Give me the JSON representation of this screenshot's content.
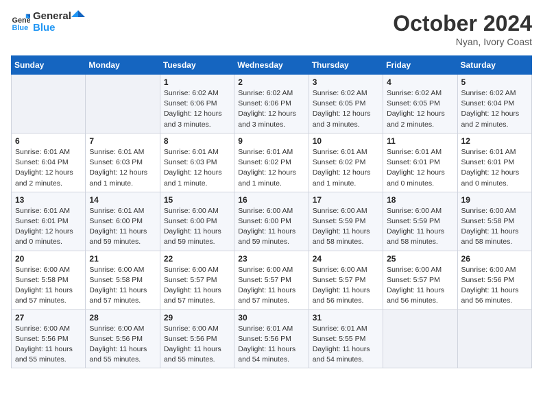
{
  "header": {
    "logo_line1": "General",
    "logo_line2": "Blue",
    "main_title": "October 2024",
    "subtitle": "Nyan, Ivory Coast"
  },
  "weekdays": [
    "Sunday",
    "Monday",
    "Tuesday",
    "Wednesday",
    "Thursday",
    "Friday",
    "Saturday"
  ],
  "weeks": [
    [
      {
        "day": "",
        "info": ""
      },
      {
        "day": "",
        "info": ""
      },
      {
        "day": "1",
        "info": "Sunrise: 6:02 AM\nSunset: 6:06 PM\nDaylight: 12 hours and 3 minutes."
      },
      {
        "day": "2",
        "info": "Sunrise: 6:02 AM\nSunset: 6:06 PM\nDaylight: 12 hours and 3 minutes."
      },
      {
        "day": "3",
        "info": "Sunrise: 6:02 AM\nSunset: 6:05 PM\nDaylight: 12 hours and 3 minutes."
      },
      {
        "day": "4",
        "info": "Sunrise: 6:02 AM\nSunset: 6:05 PM\nDaylight: 12 hours and 2 minutes."
      },
      {
        "day": "5",
        "info": "Sunrise: 6:02 AM\nSunset: 6:04 PM\nDaylight: 12 hours and 2 minutes."
      }
    ],
    [
      {
        "day": "6",
        "info": "Sunrise: 6:01 AM\nSunset: 6:04 PM\nDaylight: 12 hours and 2 minutes."
      },
      {
        "day": "7",
        "info": "Sunrise: 6:01 AM\nSunset: 6:03 PM\nDaylight: 12 hours and 1 minute."
      },
      {
        "day": "8",
        "info": "Sunrise: 6:01 AM\nSunset: 6:03 PM\nDaylight: 12 hours and 1 minute."
      },
      {
        "day": "9",
        "info": "Sunrise: 6:01 AM\nSunset: 6:02 PM\nDaylight: 12 hours and 1 minute."
      },
      {
        "day": "10",
        "info": "Sunrise: 6:01 AM\nSunset: 6:02 PM\nDaylight: 12 hours and 1 minute."
      },
      {
        "day": "11",
        "info": "Sunrise: 6:01 AM\nSunset: 6:01 PM\nDaylight: 12 hours and 0 minutes."
      },
      {
        "day": "12",
        "info": "Sunrise: 6:01 AM\nSunset: 6:01 PM\nDaylight: 12 hours and 0 minutes."
      }
    ],
    [
      {
        "day": "13",
        "info": "Sunrise: 6:01 AM\nSunset: 6:01 PM\nDaylight: 12 hours and 0 minutes."
      },
      {
        "day": "14",
        "info": "Sunrise: 6:01 AM\nSunset: 6:00 PM\nDaylight: 11 hours and 59 minutes."
      },
      {
        "day": "15",
        "info": "Sunrise: 6:00 AM\nSunset: 6:00 PM\nDaylight: 11 hours and 59 minutes."
      },
      {
        "day": "16",
        "info": "Sunrise: 6:00 AM\nSunset: 6:00 PM\nDaylight: 11 hours and 59 minutes."
      },
      {
        "day": "17",
        "info": "Sunrise: 6:00 AM\nSunset: 5:59 PM\nDaylight: 11 hours and 58 minutes."
      },
      {
        "day": "18",
        "info": "Sunrise: 6:00 AM\nSunset: 5:59 PM\nDaylight: 11 hours and 58 minutes."
      },
      {
        "day": "19",
        "info": "Sunrise: 6:00 AM\nSunset: 5:58 PM\nDaylight: 11 hours and 58 minutes."
      }
    ],
    [
      {
        "day": "20",
        "info": "Sunrise: 6:00 AM\nSunset: 5:58 PM\nDaylight: 11 hours and 57 minutes."
      },
      {
        "day": "21",
        "info": "Sunrise: 6:00 AM\nSunset: 5:58 PM\nDaylight: 11 hours and 57 minutes."
      },
      {
        "day": "22",
        "info": "Sunrise: 6:00 AM\nSunset: 5:57 PM\nDaylight: 11 hours and 57 minutes."
      },
      {
        "day": "23",
        "info": "Sunrise: 6:00 AM\nSunset: 5:57 PM\nDaylight: 11 hours and 57 minutes."
      },
      {
        "day": "24",
        "info": "Sunrise: 6:00 AM\nSunset: 5:57 PM\nDaylight: 11 hours and 56 minutes."
      },
      {
        "day": "25",
        "info": "Sunrise: 6:00 AM\nSunset: 5:57 PM\nDaylight: 11 hours and 56 minutes."
      },
      {
        "day": "26",
        "info": "Sunrise: 6:00 AM\nSunset: 5:56 PM\nDaylight: 11 hours and 56 minutes."
      }
    ],
    [
      {
        "day": "27",
        "info": "Sunrise: 6:00 AM\nSunset: 5:56 PM\nDaylight: 11 hours and 55 minutes."
      },
      {
        "day": "28",
        "info": "Sunrise: 6:00 AM\nSunset: 5:56 PM\nDaylight: 11 hours and 55 minutes."
      },
      {
        "day": "29",
        "info": "Sunrise: 6:00 AM\nSunset: 5:56 PM\nDaylight: 11 hours and 55 minutes."
      },
      {
        "day": "30",
        "info": "Sunrise: 6:01 AM\nSunset: 5:56 PM\nDaylight: 11 hours and 54 minutes."
      },
      {
        "day": "31",
        "info": "Sunrise: 6:01 AM\nSunset: 5:55 PM\nDaylight: 11 hours and 54 minutes."
      },
      {
        "day": "",
        "info": ""
      },
      {
        "day": "",
        "info": ""
      }
    ]
  ]
}
